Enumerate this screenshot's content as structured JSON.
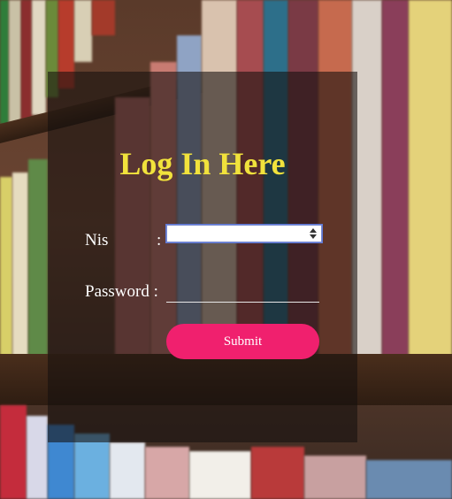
{
  "form": {
    "title": "Log In Here",
    "nis_label": "Nis",
    "nis_colon": ":",
    "nis_value": "",
    "password_label": "Password :",
    "password_value": "",
    "submit_label": "Submit"
  },
  "colors": {
    "title": "#f1e23c",
    "submit_bg": "#f0206e",
    "label_text": "#ffffff"
  },
  "icons": {
    "number_spinner": "spinner-arrows-icon"
  }
}
